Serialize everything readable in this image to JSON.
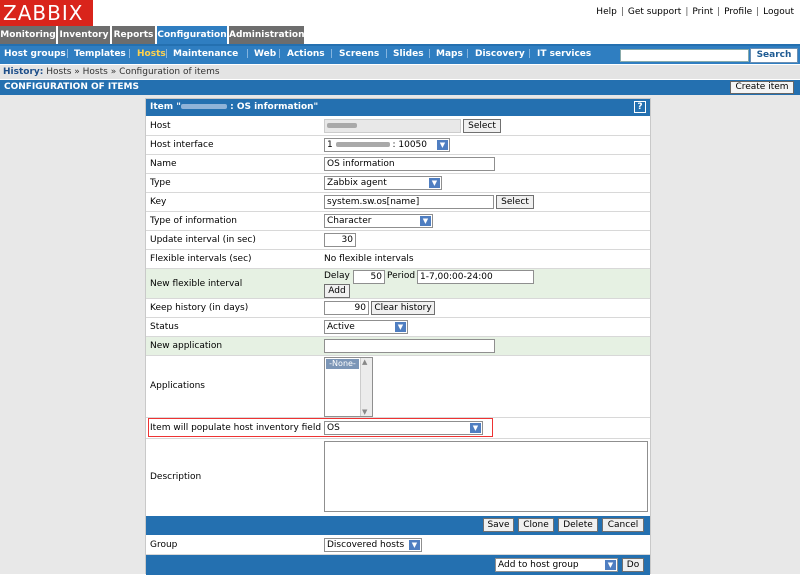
{
  "logo": "ZABBIX",
  "top_links": [
    "Help",
    "Get support",
    "Print",
    "Profile",
    "Logout"
  ],
  "main_menu": [
    {
      "label": "Monitoring",
      "active": false
    },
    {
      "label": "Inventory",
      "active": false
    },
    {
      "label": "Reports",
      "active": false
    },
    {
      "label": "Configuration",
      "active": true
    },
    {
      "label": "Administration",
      "active": false
    }
  ],
  "sub_menu": [
    {
      "label": "Host groups",
      "active": false
    },
    {
      "label": "Templates",
      "active": false
    },
    {
      "label": "Hosts",
      "active": true
    },
    {
      "label": "Maintenance",
      "active": false
    },
    {
      "label": "Web",
      "active": false
    },
    {
      "label": "Actions",
      "active": false
    },
    {
      "label": "Screens",
      "active": false
    },
    {
      "label": "Slides",
      "active": false
    },
    {
      "label": "Maps",
      "active": false
    },
    {
      "label": "Discovery",
      "active": false
    },
    {
      "label": "IT services",
      "active": false
    }
  ],
  "search": {
    "button": "Search",
    "value": ""
  },
  "history": {
    "label": "History:",
    "path": "Hosts » Hosts » Configuration of items"
  },
  "page": {
    "title": "CONFIGURATION OF ITEMS",
    "create_button": "Create item"
  },
  "form": {
    "title_prefix": "Item \"",
    "title_suffix": " : OS information\"",
    "help_icon": "?",
    "fields": {
      "host": {
        "label": "Host",
        "button": "Select"
      },
      "host_interface": {
        "label": "Host interface",
        "value_prefix": "1",
        "value_suffix": ": 10050"
      },
      "name": {
        "label": "Name",
        "value": "OS information"
      },
      "type": {
        "label": "Type",
        "value": "Zabbix agent"
      },
      "key": {
        "label": "Key",
        "value": "system.sw.os[name]",
        "button": "Select"
      },
      "type_of_information": {
        "label": "Type of information",
        "value": "Character"
      },
      "update_interval": {
        "label": "Update interval (in sec)",
        "value": "30"
      },
      "flexible_intervals": {
        "label": "Flexible intervals (sec)",
        "value": "No flexible intervals"
      },
      "new_flexible_interval": {
        "label": "New flexible interval",
        "delay_label": "Delay",
        "delay_value": "50",
        "period_label": "Period",
        "period_value": "1-7,00:00-24:00",
        "add_button": "Add"
      },
      "keep_history": {
        "label": "Keep history (in days)",
        "value": "90",
        "button": "Clear history"
      },
      "status": {
        "label": "Status",
        "value": "Active"
      },
      "new_application": {
        "label": "New application",
        "value": ""
      },
      "applications": {
        "label": "Applications",
        "options": [
          "-None-"
        ]
      },
      "inventory_field": {
        "label": "Item will populate host inventory field",
        "value": "OS"
      },
      "description": {
        "label": "Description",
        "value": ""
      }
    },
    "buttons": {
      "save": "Save",
      "clone": "Clone",
      "delete": "Delete",
      "cancel": "Cancel"
    },
    "group": {
      "label": "Group",
      "value": "Discovered hosts"
    },
    "mass_action": {
      "value": "Add to host group",
      "button": "Do"
    }
  }
}
